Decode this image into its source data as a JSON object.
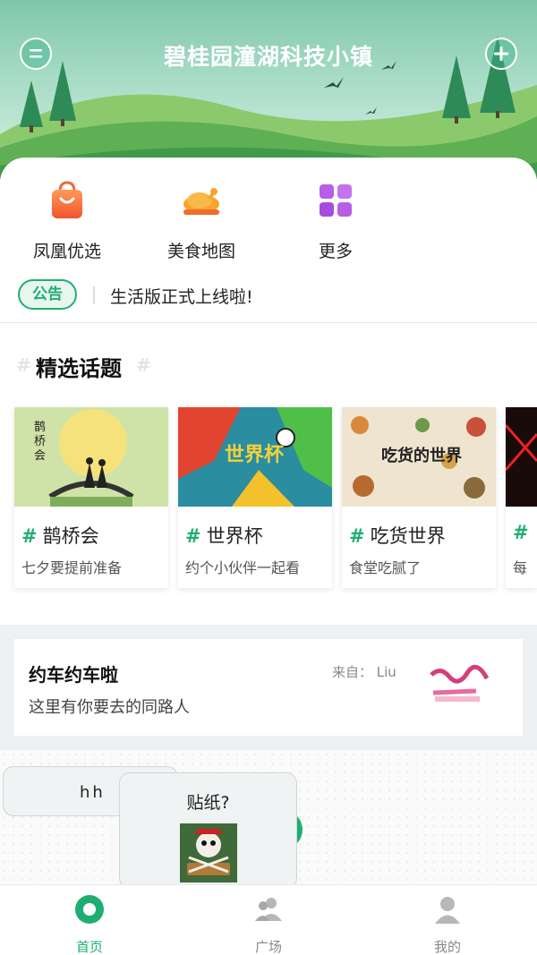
{
  "header": {
    "title": "碧桂园潼湖科技小镇",
    "menu_icon": "menu-icon",
    "add_icon": "plus-icon"
  },
  "shortcuts": [
    {
      "label": "凤凰优选",
      "icon": "shopping-bag-icon"
    },
    {
      "label": "美食地图",
      "icon": "roast-chicken-icon"
    },
    {
      "label": "更多",
      "icon": "grid-icon"
    }
  ],
  "notice": {
    "badge": "公告",
    "text": "生活版正式上线啦!"
  },
  "topics": {
    "title": "精选话题",
    "items": [
      {
        "name": "鹊桥会",
        "desc": "七夕要提前准备",
        "image_caption": "鹊\n桥\n会"
      },
      {
        "name": "世界杯",
        "desc": "约个小伙伴一起看",
        "image_caption": "世界杯"
      },
      {
        "name": "吃货世界",
        "desc": "食堂吃腻了",
        "image_caption": "吃货的世界"
      },
      {
        "name": "",
        "desc": "每"
      }
    ]
  },
  "ride": {
    "title": "约车约车啦",
    "subtitle": "这里有你要去的同路人",
    "from": "来自：  Liu"
  },
  "bubbles": {
    "first": "hh",
    "second": "贴纸?"
  },
  "tabs": [
    {
      "label": "首页",
      "icon": "home-icon",
      "active": true
    },
    {
      "label": "广场",
      "icon": "users-icon",
      "active": false
    },
    {
      "label": "我的",
      "icon": "user-icon",
      "active": false
    }
  ],
  "colors": {
    "accent": "#1fae71",
    "header_bg": "#7fc6ad"
  }
}
